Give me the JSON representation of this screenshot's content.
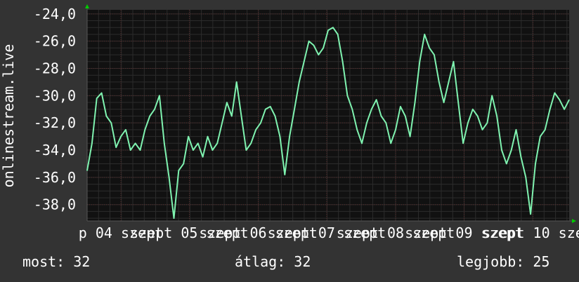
{
  "colors": {
    "background": "#333333",
    "plot_background": "#111111",
    "grid_minor": "#2c2c2c",
    "grid_major": "#5a2a2a",
    "line": "#7ff3b0",
    "text": "#ffffff",
    "axis_arrow": "#00cc00"
  },
  "chart_data": {
    "type": "line",
    "ylabel": "onlinestream.live",
    "ylim": [
      -39.2,
      -23.7
    ],
    "yticks": [
      "-24,0",
      "-26,0",
      "-28,0",
      "-30,0",
      "-32,0",
      "-34,0",
      "-36,0",
      "-38,0"
    ],
    "ytick_values": [
      -24,
      -26,
      -28,
      -30,
      -32,
      -34,
      -36,
      -38
    ],
    "xlim": [
      0,
      100
    ],
    "xticks": [
      {
        "pos": 7.0,
        "label": "p 04 szept"
      },
      {
        "pos": 21.2,
        "label": "szept 05 szept"
      },
      {
        "pos": 35.5,
        "label": "szept 06 szept"
      },
      {
        "pos": 49.7,
        "label": "szept 07 szept"
      },
      {
        "pos": 64.0,
        "label": "szept 08 szept"
      },
      {
        "pos": 78.2,
        "label": "szept 09 szept"
      },
      {
        "pos": 92.5,
        "label": "szept 10 sze"
      }
    ],
    "grid": true,
    "series": [
      {
        "values": [
          [
            0,
            -35.5
          ],
          [
            1,
            -33.5
          ],
          [
            2,
            -30.2
          ],
          [
            3,
            -29.8
          ],
          [
            4,
            -31.5
          ],
          [
            5,
            -32.0
          ],
          [
            6,
            -33.8
          ],
          [
            7,
            -33.0
          ],
          [
            8,
            -32.5
          ],
          [
            9,
            -34.0
          ],
          [
            10,
            -33.5
          ],
          [
            11,
            -34.0
          ],
          [
            12,
            -32.5
          ],
          [
            13,
            -31.5
          ],
          [
            14,
            -31.0
          ],
          [
            15,
            -30.0
          ],
          [
            16,
            -33.5
          ],
          [
            17,
            -36.0
          ],
          [
            18,
            -39.0
          ],
          [
            19,
            -35.5
          ],
          [
            20,
            -35.0
          ],
          [
            21,
            -33.0
          ],
          [
            22,
            -34.0
          ],
          [
            23,
            -33.5
          ],
          [
            24,
            -34.5
          ],
          [
            25,
            -33.0
          ],
          [
            26,
            -34.0
          ],
          [
            27,
            -33.5
          ],
          [
            28,
            -32.0
          ],
          [
            29,
            -30.5
          ],
          [
            30,
            -31.5
          ],
          [
            31,
            -29.0
          ],
          [
            32,
            -31.5
          ],
          [
            33,
            -34.0
          ],
          [
            34,
            -33.5
          ],
          [
            35,
            -32.5
          ],
          [
            36,
            -32.0
          ],
          [
            37,
            -31.0
          ],
          [
            38,
            -30.8
          ],
          [
            39,
            -31.5
          ],
          [
            40,
            -33.0
          ],
          [
            41,
            -35.8
          ],
          [
            42,
            -33.0
          ],
          [
            43,
            -31.0
          ],
          [
            44,
            -29.0
          ],
          [
            45,
            -27.5
          ],
          [
            46,
            -26.0
          ],
          [
            47,
            -26.3
          ],
          [
            48,
            -27.0
          ],
          [
            49,
            -26.5
          ],
          [
            50,
            -25.2
          ],
          [
            51,
            -25.0
          ],
          [
            52,
            -25.5
          ],
          [
            53,
            -27.5
          ],
          [
            54,
            -30.0
          ],
          [
            55,
            -31.0
          ],
          [
            56,
            -32.5
          ],
          [
            57,
            -33.5
          ],
          [
            58,
            -32.0
          ],
          [
            59,
            -31.0
          ],
          [
            60,
            -30.3
          ],
          [
            61,
            -31.5
          ],
          [
            62,
            -32.0
          ],
          [
            63,
            -33.5
          ],
          [
            64,
            -32.5
          ],
          [
            65,
            -30.8
          ],
          [
            66,
            -31.5
          ],
          [
            67,
            -33.0
          ],
          [
            68,
            -30.5
          ],
          [
            69,
            -27.5
          ],
          [
            70,
            -25.5
          ],
          [
            71,
            -26.5
          ],
          [
            72,
            -27.0
          ],
          [
            73,
            -29.0
          ],
          [
            74,
            -30.5
          ],
          [
            75,
            -29.0
          ],
          [
            76,
            -27.5
          ],
          [
            77,
            -30.5
          ],
          [
            78,
            -33.5
          ],
          [
            79,
            -32.0
          ],
          [
            80,
            -31.0
          ],
          [
            81,
            -31.5
          ],
          [
            82,
            -32.5
          ],
          [
            83,
            -32.0
          ],
          [
            84,
            -30.0
          ],
          [
            85,
            -31.5
          ],
          [
            86,
            -34.0
          ],
          [
            87,
            -35.0
          ],
          [
            88,
            -34.0
          ],
          [
            89,
            -32.5
          ],
          [
            90,
            -34.5
          ],
          [
            91,
            -36.0
          ],
          [
            92,
            -38.7
          ],
          [
            93,
            -35.0
          ],
          [
            94,
            -33.0
          ],
          [
            95,
            -32.5
          ],
          [
            96,
            -31.0
          ],
          [
            97,
            -29.8
          ],
          [
            98,
            -30.3
          ],
          [
            99,
            -31.0
          ],
          [
            100,
            -30.3
          ]
        ]
      }
    ]
  },
  "stats": {
    "current": "most: 32",
    "average": "átlag: 32",
    "best": "legjobb: 25"
  }
}
